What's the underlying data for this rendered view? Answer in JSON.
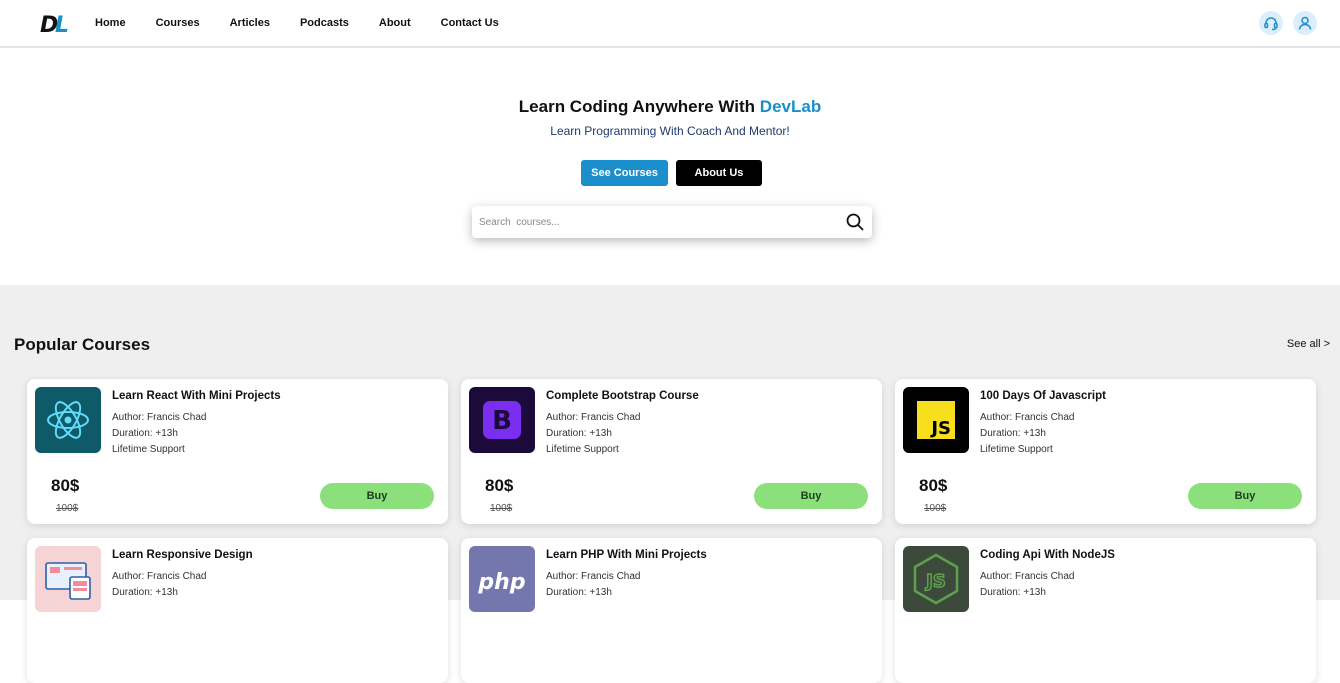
{
  "header": {
    "logo_text": "DL",
    "nav": [
      "Home",
      "Courses",
      "Articles",
      "Podcasts",
      "About",
      "Contact Us"
    ],
    "icons": [
      "headset-icon",
      "user-icon"
    ],
    "accent": "#1a8fcb"
  },
  "hero": {
    "title_prefix": "Learn Coding Anywhere With ",
    "title_brand": "DevLab",
    "subtitle": "Learn Programming With Coach And Mentor!",
    "see_courses": "See Courses",
    "about_us": "About Us",
    "search_placeholder": "Search  courses..."
  },
  "courses": {
    "section_title": "Popular Courses",
    "see_all": "See all >",
    "items": [
      {
        "title": "Learn React With Mini Projects",
        "author": "Author: Francis Chad",
        "duration": "Duration: +13h",
        "support": "Lifetime Support",
        "price": "80$",
        "old_price": "100$",
        "buy": "Buy",
        "icon": "react-icon"
      },
      {
        "title": "Complete Bootstrap Course",
        "author": "Author: Francis Chad",
        "duration": "Duration: +13h",
        "support": "Lifetime Support",
        "price": "80$",
        "old_price": "100$",
        "buy": "Buy",
        "icon": "bootstrap-icon"
      },
      {
        "title": "100 Days Of Javascript",
        "author": "Author: Francis Chad",
        "duration": "Duration: +13h",
        "support": "Lifetime Support",
        "price": "80$",
        "old_price": "100$",
        "buy": "Buy",
        "icon": "javascript-icon"
      },
      {
        "title": "Learn Responsive Design",
        "author": "Author: Francis Chad",
        "duration": "Duration: +13h",
        "icon": "responsive-design-icon"
      },
      {
        "title": "Learn PHP With Mini Projects",
        "author": "Author: Francis Chad",
        "duration": "Duration: +13h",
        "icon": "php-icon"
      },
      {
        "title": "Coding Api With NodeJS",
        "author": "Author: Francis Chad",
        "duration": "Duration: +13h",
        "icon": "nodejs-icon"
      }
    ]
  }
}
